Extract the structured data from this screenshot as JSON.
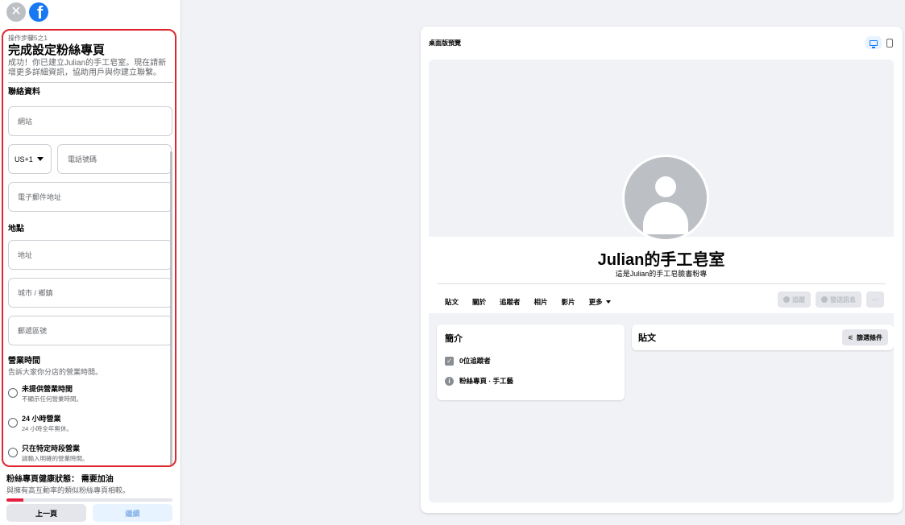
{
  "header": {
    "close_glyph": "✕",
    "logo_glyph": "f",
    "icons": [
      "close-icon",
      "facebook-logo-icon"
    ]
  },
  "steps": {
    "step_label": "操作步驟5之1",
    "title": "完成設定粉絲專頁",
    "description": "成功！你已建立Julian的手工皂室。現在請新增更多詳細資訊，協助用戶與你建立聯繫。"
  },
  "contact": {
    "heading": "聯絡資料",
    "website_placeholder": "網站",
    "phone_code": "US+1",
    "phone_placeholder": "電話號碼",
    "email_placeholder": "電子郵件地址"
  },
  "location": {
    "heading": "地點",
    "address_placeholder": "地址",
    "city_placeholder": "城市 / 鄉鎮",
    "zip_placeholder": "郵遞區號"
  },
  "hours": {
    "heading": "營業時間",
    "subtitle": "告訴大家你分店的營業時間。",
    "options": [
      {
        "title": "未提供營業時間",
        "subtitle": "不顯示任何營業時間。"
      },
      {
        "title": "24 小時營業",
        "subtitle": "24 小時全年無休。"
      },
      {
        "title": "只在特定時段營業",
        "subtitle": "請輸入明確的營業時間。"
      }
    ]
  },
  "health": {
    "title": "粉絲專頁健康狀態： 需要加油",
    "subtitle": "與擁有高互動率的類似粉絲專頁相較。",
    "progress": 0.1,
    "color": "#e41e3f"
  },
  "buttons": {
    "prev": "上一頁",
    "next": "繼續"
  },
  "preview": {
    "title": "桌面版預覽",
    "devices": [
      "desktop-icon",
      "mobile-icon"
    ],
    "page_name": "Julian的手工皂室",
    "page_subtitle": "這是Julian的手工皂臉書粉專",
    "tabs": [
      "貼文",
      "關於",
      "追蹤者",
      "相片",
      "影片",
      "更多"
    ],
    "actions": {
      "follow": "追蹤",
      "message": "發送訊息",
      "more": "···"
    },
    "intro": {
      "title": "簡介",
      "followers": "0位追蹤者",
      "category": "粉絲專頁 · 手工藝",
      "category_icon_glyph": "i"
    },
    "posts": {
      "title": "貼文",
      "filter": "篩選條件",
      "filter_glyph": "⚟"
    }
  },
  "colors": {
    "brand": "#1877f2",
    "highlight": "#e0262e",
    "background": "#f0f2f5"
  }
}
